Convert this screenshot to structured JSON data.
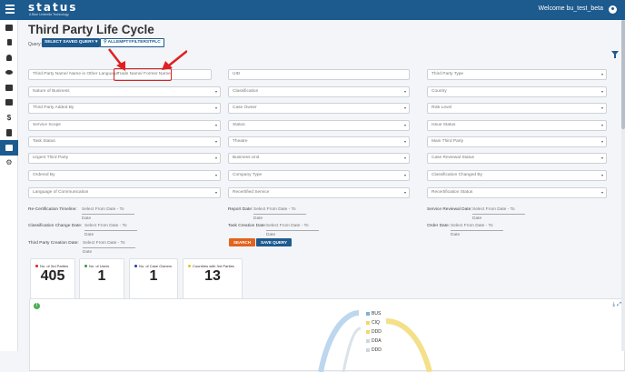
{
  "header": {
    "logo_text": "status",
    "logo_sub": "A Blue Umbrella Technology",
    "welcome": "Welcome bu_test_beta"
  },
  "sidebar": {
    "icons": [
      "table-icon",
      "list-icon",
      "bell-icon",
      "eye-icon",
      "monitor-icon",
      "checklist-icon",
      "dollar-icon",
      "document-icon",
      "chart-icon",
      "gear-icon"
    ],
    "active_index": 8
  },
  "page": {
    "title": "Third Party Life Cycle",
    "query_label": "Query:",
    "select_query": "SELECT SAVED QUERY",
    "filter_chip": "ALLEMPTYFILTERSTPLC"
  },
  "fields": {
    "r1c1_a": "Third Party Name/ Name in Other Language",
    "r1c1_b": "Trade Name/ Former Name",
    "r1c2": "UID",
    "r1c3": "Third Party Type",
    "r2c1": "Nature of Business",
    "r2c2": "Classification",
    "r2c3": "Country",
    "r3c1": "Third Party Added By",
    "r3c2": "Case Owner",
    "r3c3": "Risk Level",
    "r4c1": "Service Scope",
    "r4c2": "Status",
    "r4c3": "Issue Status",
    "r5c1": "Task Status",
    "r5c2": "Theatre",
    "r5c3": "Main Third Party",
    "r6c1": "Urgent Third Party",
    "r6c2": "Business Unit",
    "r6c3": "Case Reviewal Status",
    "r7c1": "Ordered By",
    "r7c2": "Company Type",
    "r7c3": "Classification Changed By",
    "r8c1": "Language of Communication",
    "r8c2": "Recertified Service",
    "r8c3": "Recertification Status"
  },
  "dates": {
    "recert_label": "Re-Certification Timeline:",
    "report_label": "Report Date:",
    "service_label": "Service Reviewal Date:",
    "class_label": "Classification Change Date:",
    "task_label": "Task Creation Date:",
    "order_label": "Order Date:",
    "creation_label": "Third Party Creation Date:",
    "placeholder": "Select From Date - To Date"
  },
  "actions": {
    "search": "SEARCH",
    "save_query": "SAVE QUERY"
  },
  "stats": [
    {
      "label": "No. of 3rd Parties",
      "value": "405",
      "color": "#e02020"
    },
    {
      "label": "No. of Users",
      "value": "1",
      "color": "#2e9e3a"
    },
    {
      "label": "No. of Case Owners",
      "value": "1",
      "color": "#1d3fa0"
    },
    {
      "label": "Countries with 3rd Parties",
      "value": "13",
      "color": "#e6c420"
    }
  ],
  "flow": {
    "labels": [
      "BUS",
      "CIQ",
      "DDD",
      "DDA",
      "DDD"
    ],
    "colors": [
      "#7fb0d8",
      "#f4d76a",
      "#f4d76a",
      "#cfd6de",
      "#cfd6de"
    ]
  },
  "colors": {
    "primary": "#1d5a8e",
    "accent": "#e1641f",
    "highlight": "#e02020"
  }
}
